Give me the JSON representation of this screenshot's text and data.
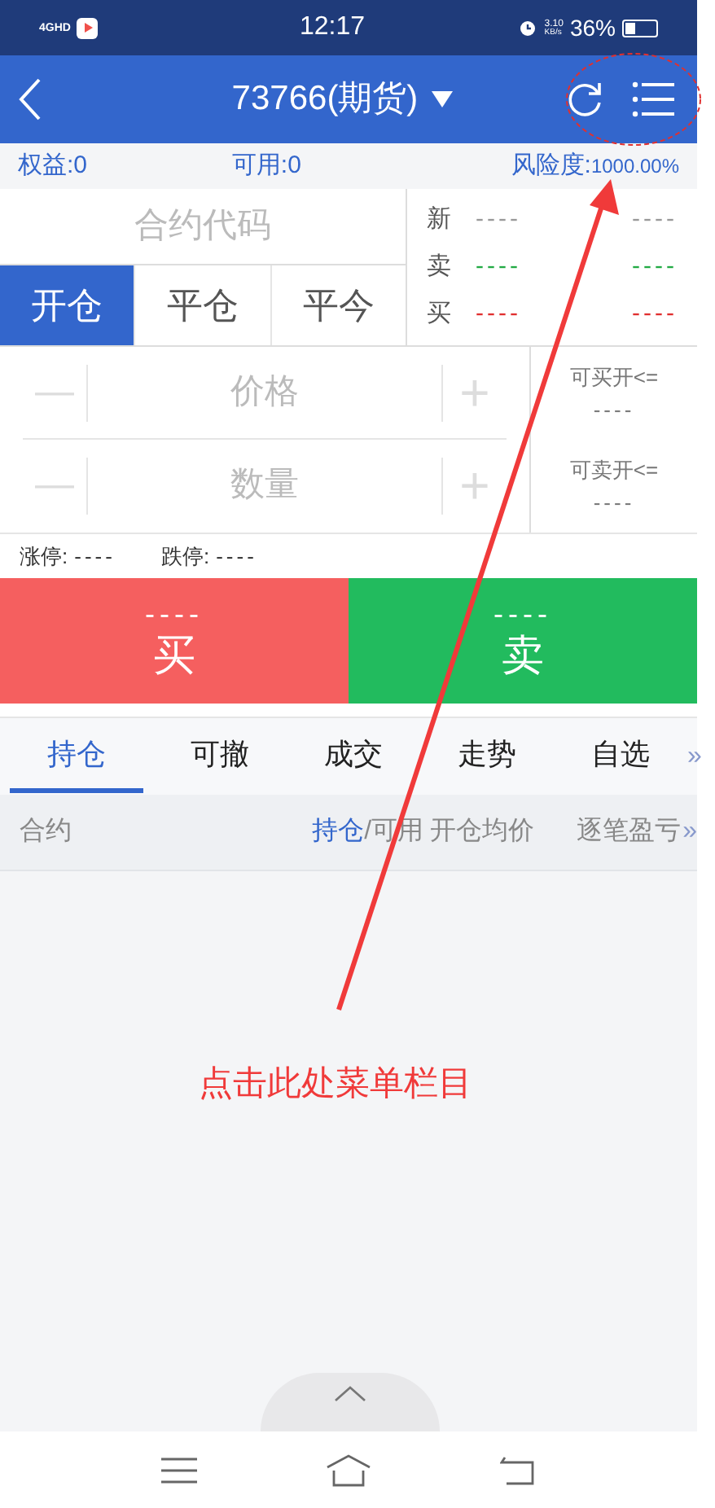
{
  "status_bar": {
    "network": "4GHD",
    "time": "12:17",
    "speed": "3.10",
    "speed_unit": "KB/s",
    "battery": "36%"
  },
  "header": {
    "title": "73766(期货)"
  },
  "account": [
    {
      "label": "权益:",
      "value": "0"
    },
    {
      "label": "可用:",
      "value": "0"
    },
    {
      "label": "风险度:",
      "value": "1000.00%"
    }
  ],
  "contract_field": {
    "placeholder": "合约代码"
  },
  "order_tabs": [
    {
      "label": "开仓",
      "selected": true
    },
    {
      "label": "平仓",
      "selected": false
    },
    {
      "label": "平今",
      "selected": false
    }
  ],
  "quotes": [
    {
      "label": "新",
      "left": "----",
      "right": "----",
      "color": "#999999"
    },
    {
      "label": "卖",
      "left": "----",
      "right": "----",
      "color": "#22aa44"
    },
    {
      "label": "买",
      "left": "----",
      "right": "----",
      "color": "#e03030"
    }
  ],
  "inputs": [
    {
      "placeholder": "价格",
      "minus": "—",
      "plus": "+"
    },
    {
      "placeholder": "数量",
      "minus": "—",
      "plus": "+"
    }
  ],
  "max_open": [
    {
      "label": "可买开<=",
      "value": "----"
    },
    {
      "label": "可卖开<=",
      "value": "----"
    }
  ],
  "limits": [
    {
      "label": "涨停:",
      "value": "----"
    },
    {
      "label": "跌停:",
      "value": "----"
    }
  ],
  "trade_buttons": [
    {
      "kind": "buy",
      "price": "----",
      "label": "买"
    },
    {
      "kind": "sell",
      "price": "----",
      "label": "卖"
    }
  ],
  "bottom_tabs": [
    {
      "label": "持仓",
      "selected": true
    },
    {
      "label": "可撤",
      "selected": false
    },
    {
      "label": "成交",
      "selected": false
    },
    {
      "label": "走势",
      "selected": false
    },
    {
      "label": "自选",
      "selected": false
    }
  ],
  "bottom_tabs_more": "»",
  "columns": {
    "contract": "合约",
    "position": {
      "highlight": "持仓",
      "rest": "/可用"
    },
    "avg_price": "开仓均价",
    "pnl": "逐笔盈亏",
    "more": "»"
  },
  "annotation": {
    "text": "点击此处菜单栏目"
  }
}
